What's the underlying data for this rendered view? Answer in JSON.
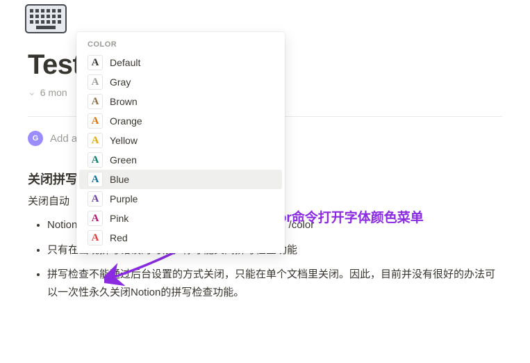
{
  "page": {
    "title": "Test",
    "meta": "6 mon",
    "avatar_letter": "G",
    "add_placeholder": "Add a",
    "heading": "关闭拼写",
    "subtext": "关闭自动",
    "bullets": [
      "Notion                                                                      端的拼写检查功能一般由浏览器或插件提供。/color",
      "只有在出现拼写错误的时候，你才能关闭拼写检查功能",
      "拼写检查不能通过后台设置的方式关闭，只能在单个文档里关闭。因此，目前并没有很好的办法可以一次性永久关闭Notion的拼写检查功能。"
    ]
  },
  "popover": {
    "header": "COLOR",
    "items": [
      {
        "label": "Default",
        "hex": "#37352f",
        "selected": false
      },
      {
        "label": "Gray",
        "hex": "#9b9a97",
        "selected": false
      },
      {
        "label": "Brown",
        "hex": "#8a6e4b",
        "selected": false
      },
      {
        "label": "Orange",
        "hex": "#d9730d",
        "selected": false
      },
      {
        "label": "Yellow",
        "hex": "#dfab01",
        "selected": false
      },
      {
        "label": "Green",
        "hex": "#0f7b6c",
        "selected": false
      },
      {
        "label": "Blue",
        "hex": "#0b6e99",
        "selected": true
      },
      {
        "label": "Purple",
        "hex": "#6940a5",
        "selected": false
      },
      {
        "label": "Pink",
        "hex": "#ad1a72",
        "selected": false
      },
      {
        "label": "Red",
        "hex": "#e03e3e",
        "selected": false
      }
    ]
  },
  "annotation": {
    "text": "输入/color命令打开字体颜色菜单",
    "arrow_color": "#8a2be2"
  }
}
